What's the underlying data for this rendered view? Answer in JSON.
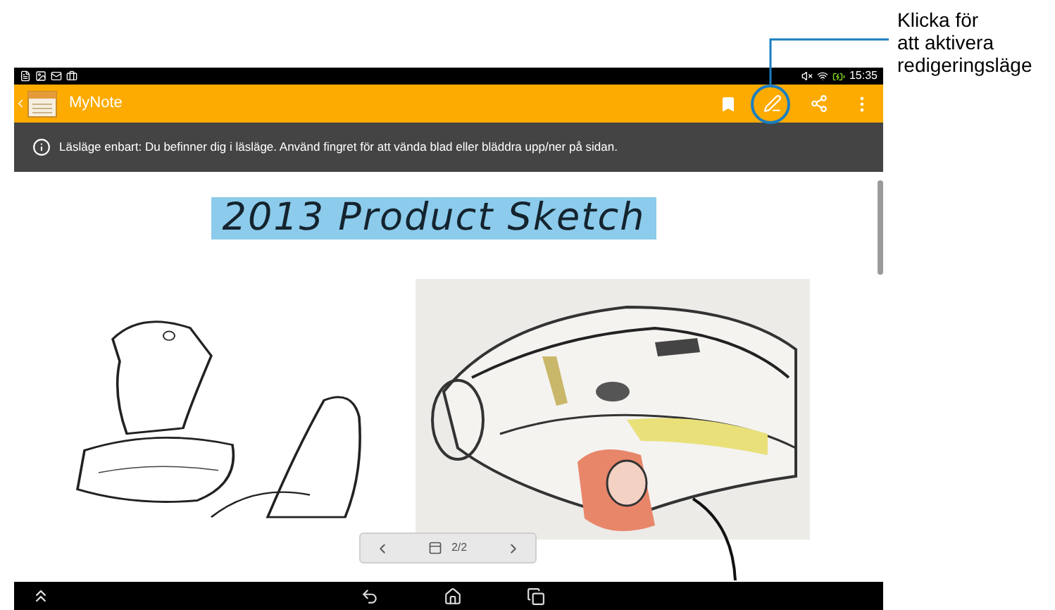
{
  "callout": {
    "lines": [
      "Klicka för",
      "att aktivera",
      "redigeringsläge"
    ]
  },
  "status_bar": {
    "time": "15:35"
  },
  "app_bar": {
    "title": "MyNote"
  },
  "notice": {
    "text": "Läsläge enbart: Du befinner dig i läsläge. Använd fingret för att vända blad eller bläddra upp/ner på sidan."
  },
  "note": {
    "title": "2013 Product Sketch"
  },
  "pager": {
    "page": "2/2"
  }
}
